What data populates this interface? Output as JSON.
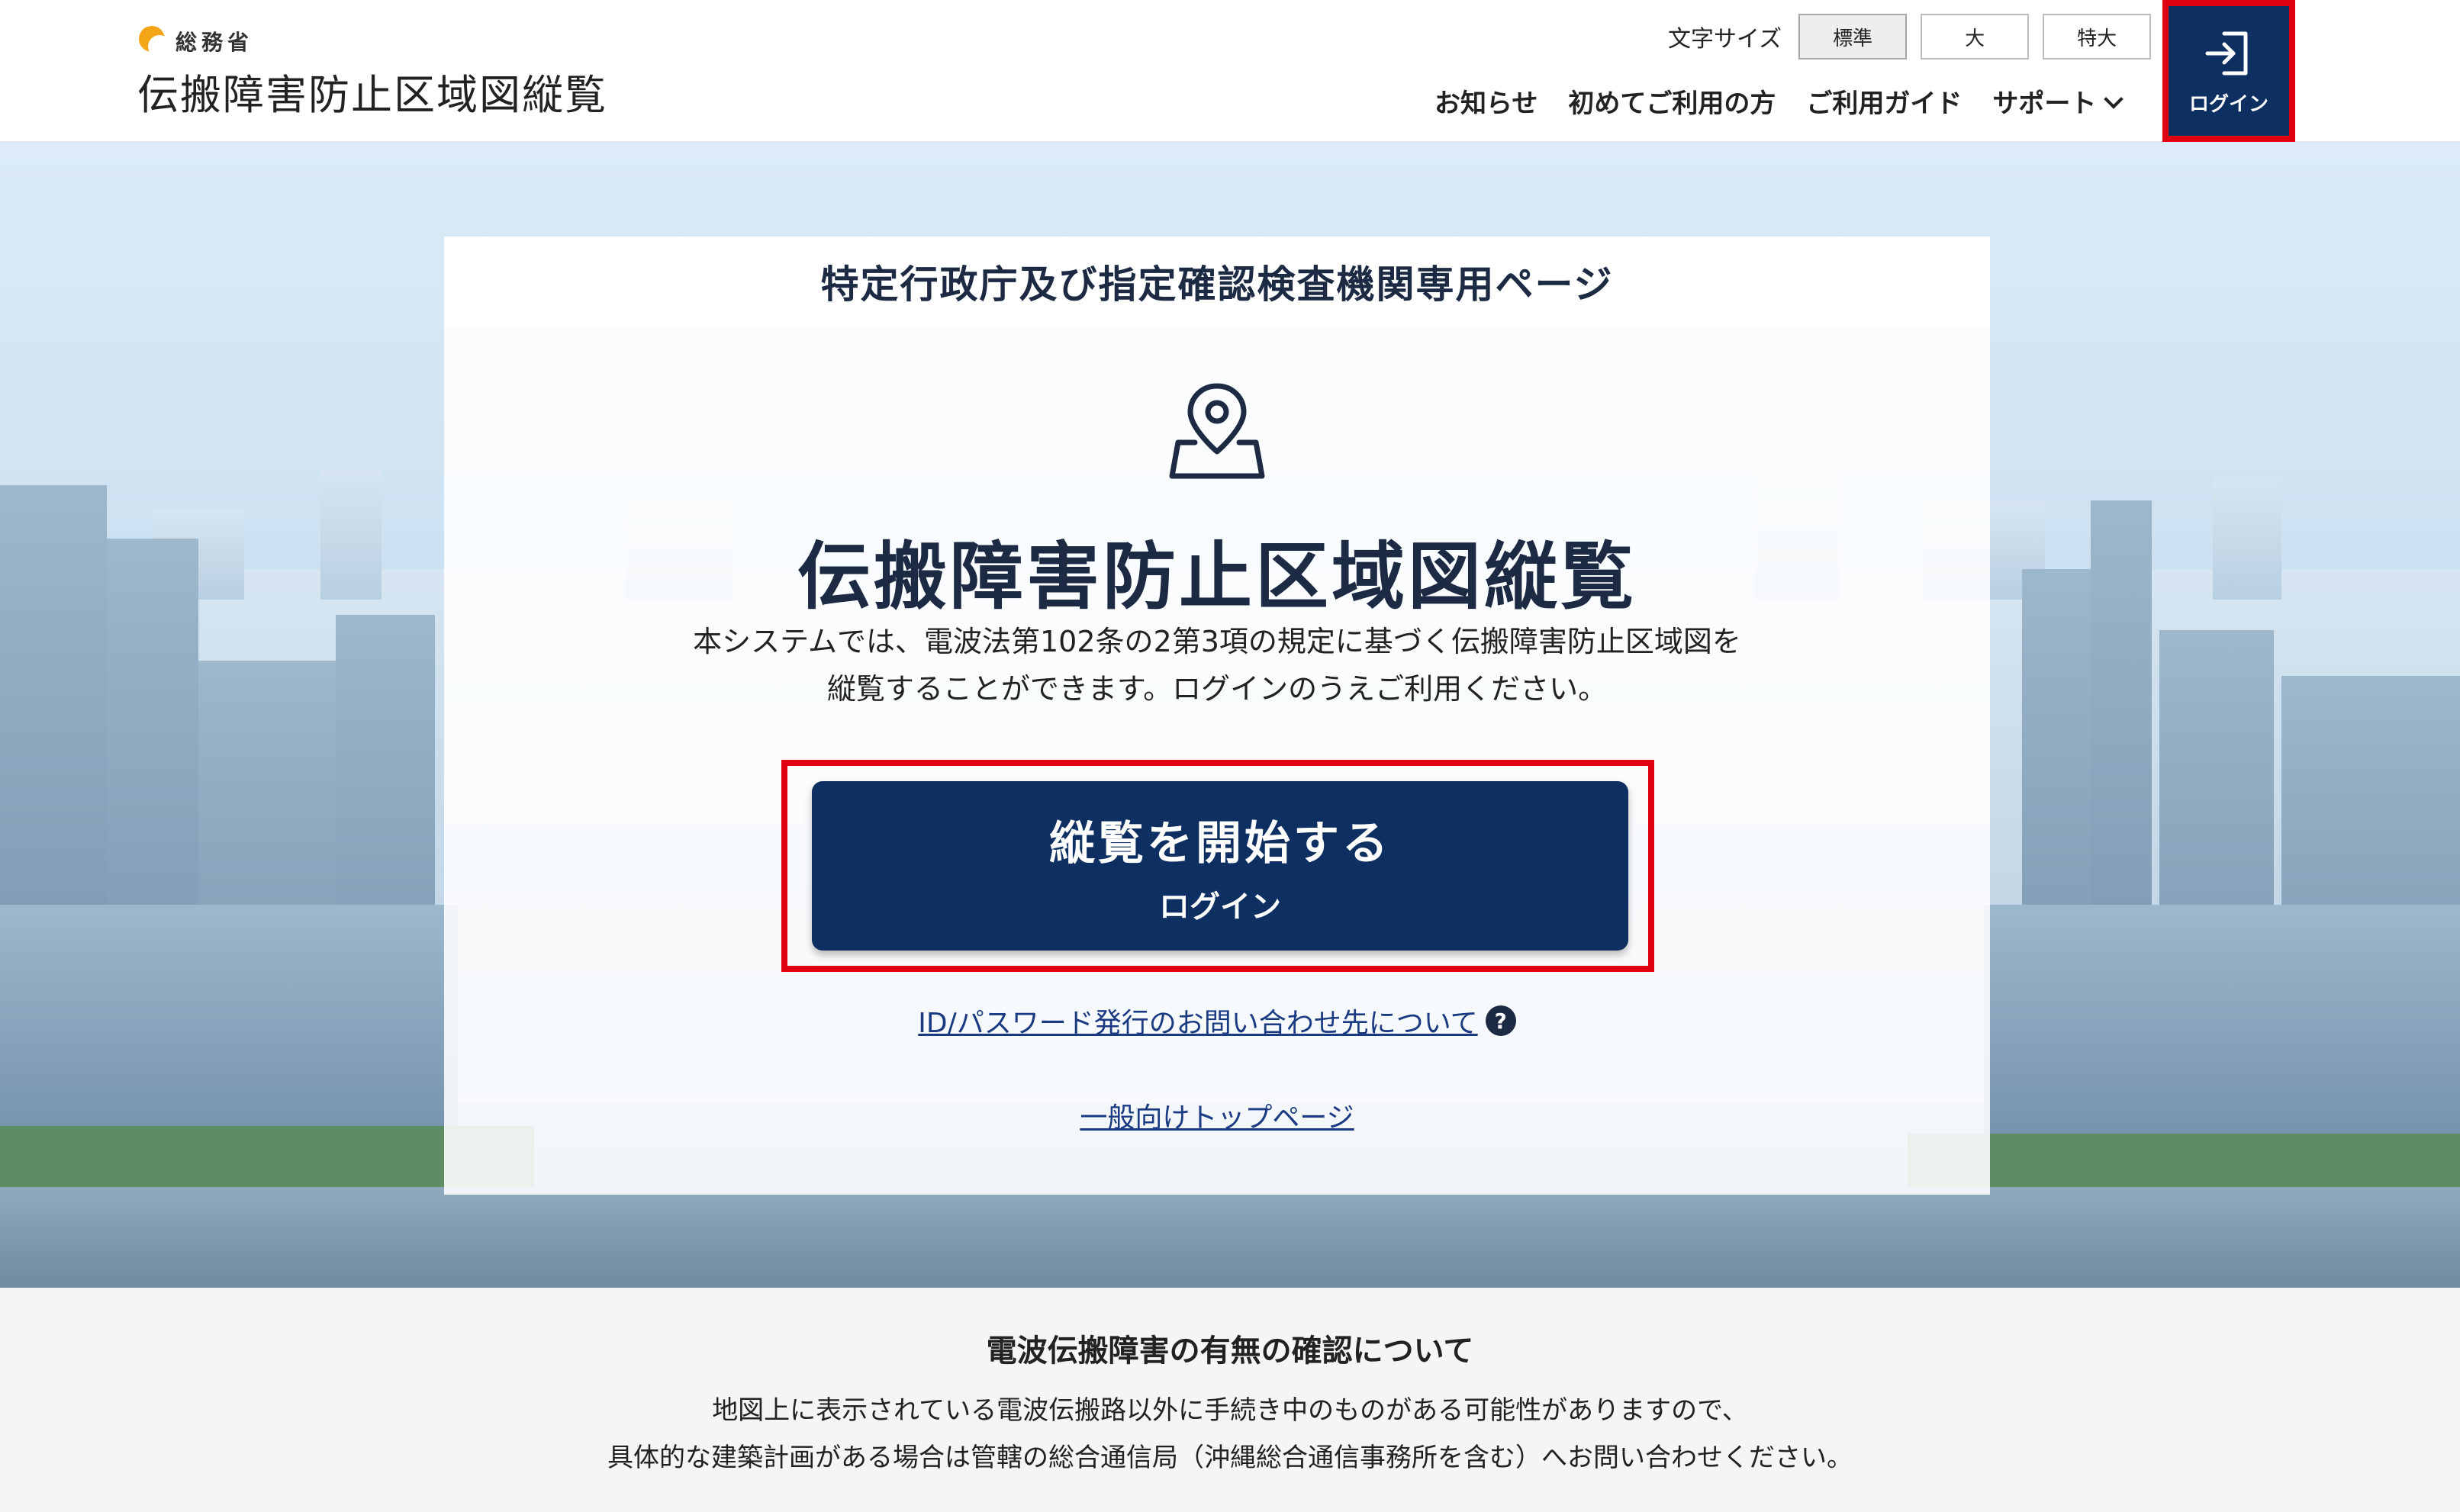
{
  "header": {
    "ministry": "総務省",
    "site_title": "伝搬障害防止区域図縦覧",
    "font_size_label": "文字サイズ",
    "font_sizes": [
      "標準",
      "大",
      "特大"
    ],
    "nav": [
      "お知らせ",
      "初めてご利用の方",
      "ご利用ガイド",
      "サポート"
    ],
    "login_label": "ログイン"
  },
  "card": {
    "header": "特定行政庁及び指定確認検査機関専用ページ",
    "title": "伝搬障害防止区域図縦覧",
    "desc_line1": "本システムでは、電波法第102条の2第3項の規定に基づく伝搬障害防止区域図を",
    "desc_line2": "縦覧することができます。ログインのうえご利用ください。",
    "start_main": "縦覧を開始する",
    "start_sub": "ログイン",
    "id_link": "ID/パスワード発行のお問い合わせ先について",
    "help_mark": "?",
    "top_link": "一般向けトップページ"
  },
  "info": {
    "title": "電波伝搬障害の有無の確認について",
    "line1": "地図上に表示されている電波伝搬路以外に手続き中のものがある可能性がありますので、",
    "line2": "具体的な建築計画がある場合は管轄の総合通信局（沖縄総合通信事務所を含む）へお問い合わせください。"
  },
  "colors": {
    "primary": "#0d2f62",
    "highlight": "#e00012",
    "ministry_mark": "#f3a516",
    "link": "#1a3b82"
  },
  "icons": {
    "ministry": "ministry-logo-icon",
    "login": "sign-in-icon",
    "map": "map-pin-icon",
    "help": "help-circle-icon",
    "support_chevron": "chevron-down-icon"
  }
}
